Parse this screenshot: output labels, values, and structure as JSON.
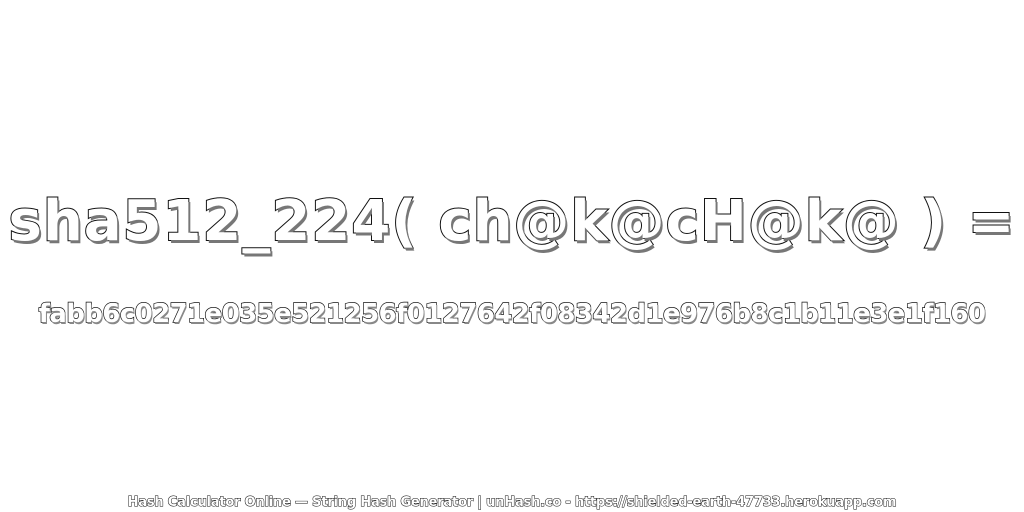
{
  "headline": {
    "text": "sha512_224( ch@k@cH@k@ ) ="
  },
  "digest": {
    "text": "fabb6c0271e035e521256f0127642f08342d1e976b8c1b11e3e1f160"
  },
  "footer": {
    "text": "Hash Calculator Online — String Hash Generator | unHash.co - https://shielded-earth-47733.herokuapp.com"
  }
}
